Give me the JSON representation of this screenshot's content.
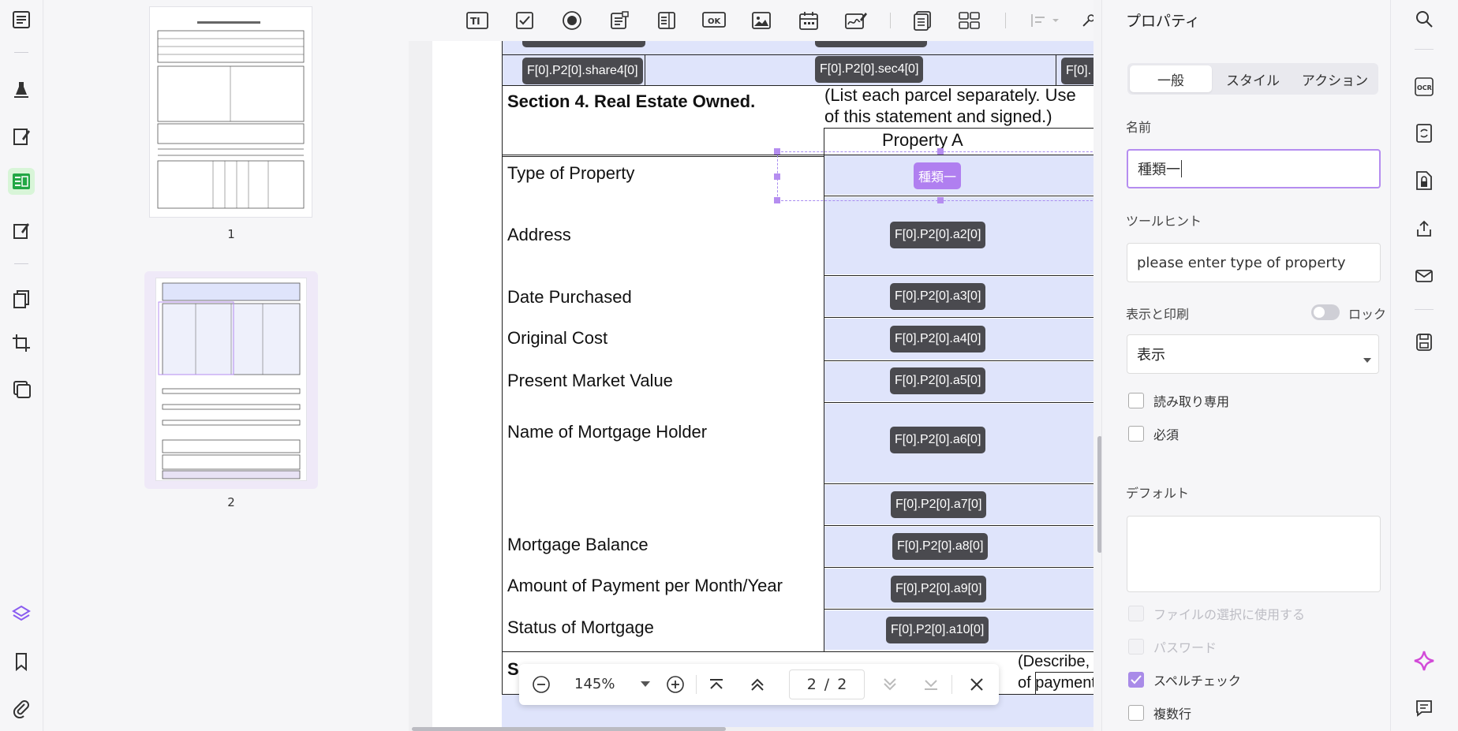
{
  "thumbnails": {
    "page1_label": "1",
    "page2_label": "2"
  },
  "document": {
    "top_fields": [
      "F[0].P2[0].share4[0]",
      "F[0].P2[0].sec4[0]",
      "F[0]."
    ],
    "section4_title": "Section 4. Real Estate Owned.",
    "section4_note_line1": "(List each parcel separately.  Use",
    "section4_note_line2": "of this statement and signed.)",
    "property_header": "Property A",
    "rows": [
      {
        "label": "Type of Property",
        "field": "種類一"
      },
      {
        "label": "Address",
        "field": "F[0].P2[0].a2[0]"
      },
      {
        "label": "Date Purchased",
        "field": "F[0].P2[0].a3[0]"
      },
      {
        "label": "Original Cost",
        "field": "F[0].P2[0].a4[0]"
      },
      {
        "label": "Present Market Value",
        "field": "F[0].P2[0].a5[0]"
      },
      {
        "label": "Name of Mortgage Holder",
        "field": "F[0].P2[0].a6[0]"
      },
      {
        "label": "",
        "field": "F[0].P2[0].a7[0]"
      },
      {
        "label": "Mortgage Balance",
        "field": "F[0].P2[0].a8[0]"
      },
      {
        "label": "Amount of Payment per Month/Year",
        "field": "F[0].P2[0].a9[0]"
      },
      {
        "label": "Status of Mortgage",
        "field": "F[0].P2[0].a10[0]"
      }
    ],
    "section5_start": "S",
    "section5_note_line1": "(Describe, and",
    "section5_note_line2": "of payment an"
  },
  "bottom_bar": {
    "zoom": "145%",
    "page_current": "2",
    "page_sep": "/",
    "page_total": "2"
  },
  "properties": {
    "title": "プロパティ",
    "tabs": [
      "一般",
      "スタイル",
      "アクション"
    ],
    "name_label": "名前",
    "name_value": "種類一",
    "tooltip_label": "ツールヒント",
    "tooltip_value": "please enter type of property",
    "display_label": "表示と印刷",
    "lock_label": "ロック",
    "display_value": "表示",
    "readonly_label": "読み取り専用",
    "required_label": "必須",
    "default_label": "デフォルト",
    "file_select_label": "ファイルの選択に使用する",
    "password_label": "パスワード",
    "spellcheck_label": "スペルチェック",
    "multiline_label": "複数行"
  },
  "colors": {
    "accent": "#a98be8",
    "field_bg": "#dfe4fb",
    "chip_bg": "#4a4a4f",
    "selected_chip": "#b07ff0"
  }
}
